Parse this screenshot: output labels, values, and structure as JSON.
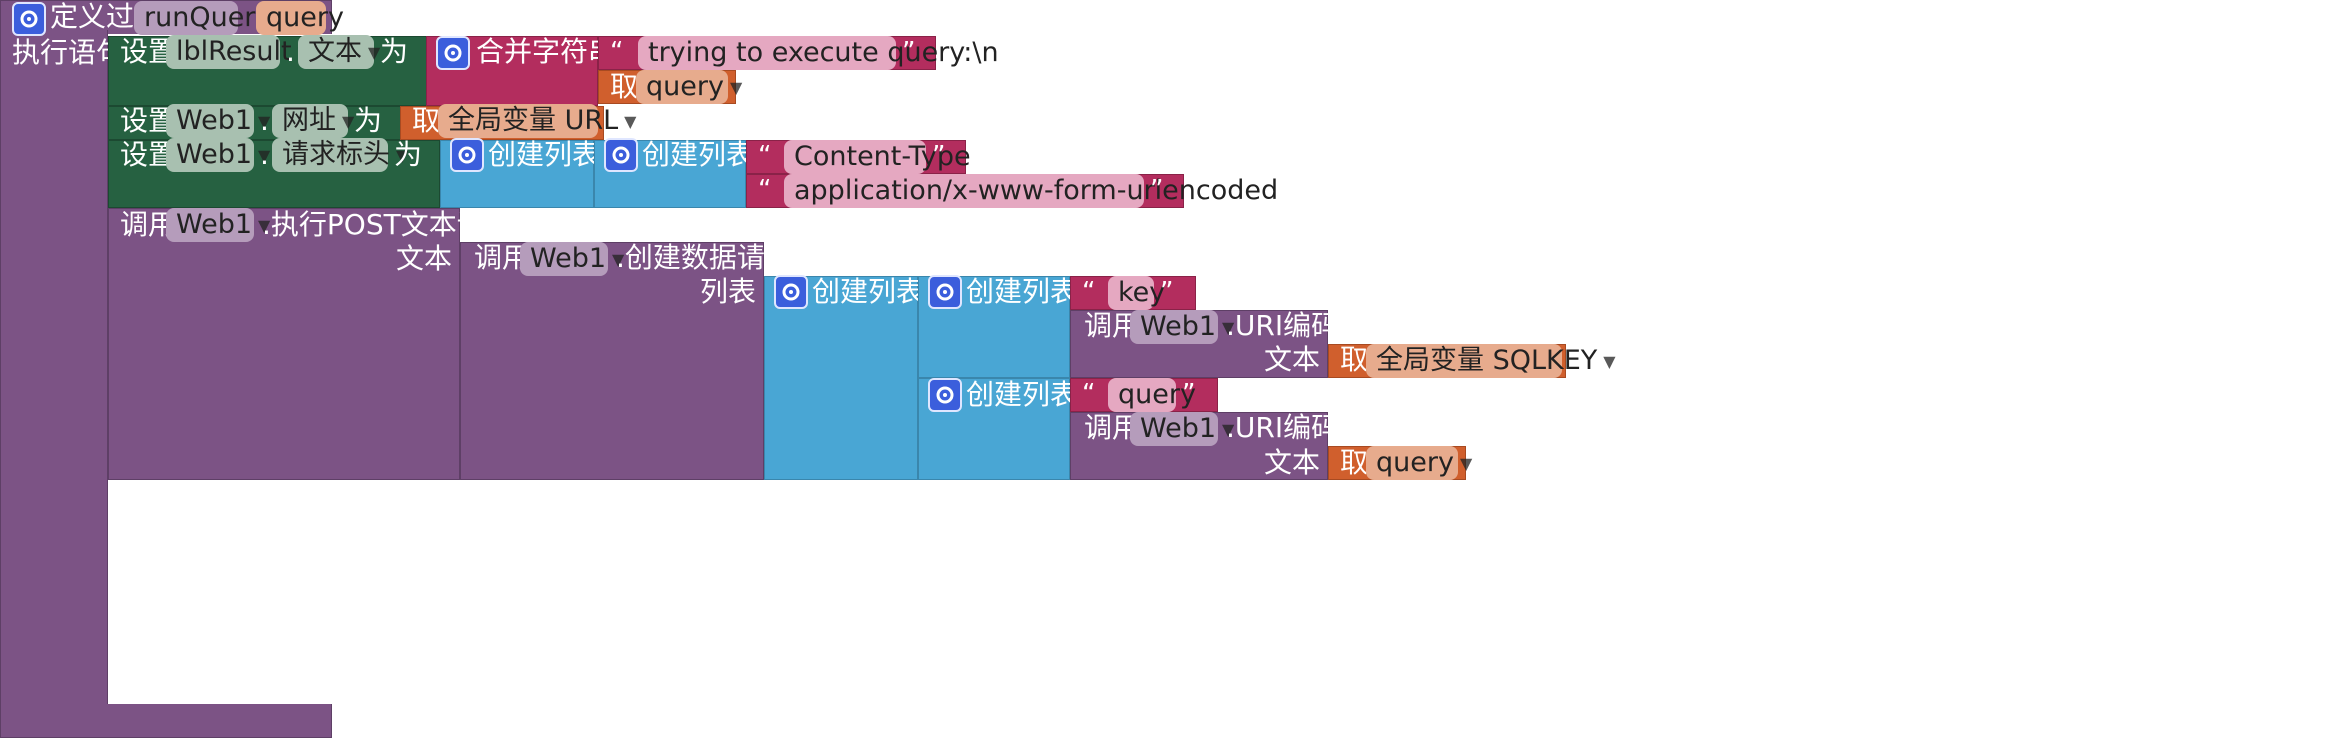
{
  "proc": {
    "title": "定义过程",
    "name": "runQuery",
    "param": "query",
    "do_label": "执行语句"
  },
  "set1": {
    "set": "设置",
    "component": "lblResult",
    "prop": "文本",
    "to": "为"
  },
  "join": {
    "label": "合并字符串",
    "text1": "trying to execute query:\\n",
    "get": "取",
    "var": "query"
  },
  "set2": {
    "set": "设置",
    "component": "Web1",
    "prop": "网址",
    "to": "为",
    "get": "取",
    "var": "全局变量 URL"
  },
  "set3": {
    "set": "设置",
    "component": "Web1",
    "prop": "请求标头",
    "to": "为",
    "list1": "创建列表",
    "list2": "创建列表",
    "text1": "Content-Type",
    "text2": "application/x-www-form-urlencoded"
  },
  "post": {
    "call": "调用",
    "component": "Web1",
    "method": ".执行POST文本请求",
    "arg": "文本"
  },
  "build": {
    "call": "调用",
    "component": "Web1",
    "method": ".创建数据请求",
    "arg": "列表",
    "list_outer": "创建列表",
    "list_a": "创建列表",
    "list_b": "创建列表",
    "key_text": "key",
    "uri_call": "调用",
    "uri_component": "Web1",
    "uri_method": ".URI编码",
    "uri_arg": "文本",
    "get": "取",
    "sqlkey_var": "全局变量 SQLKEY",
    "query_text": "query",
    "uri2_call": "调用",
    "uri2_component": "Web1",
    "uri2_method": ".URI编码",
    "uri2_arg": "文本",
    "query_var": "query"
  },
  "glyphs": {
    "open_quote": "“",
    "close_quote": "”",
    "dropdown": "▼"
  },
  "colors": {
    "procedure": "#7c5385",
    "setter": "#266141",
    "text": "#b32d5e",
    "list": "#49a6d4",
    "variable": "#d05f2d",
    "gear": "#3b5edc"
  }
}
